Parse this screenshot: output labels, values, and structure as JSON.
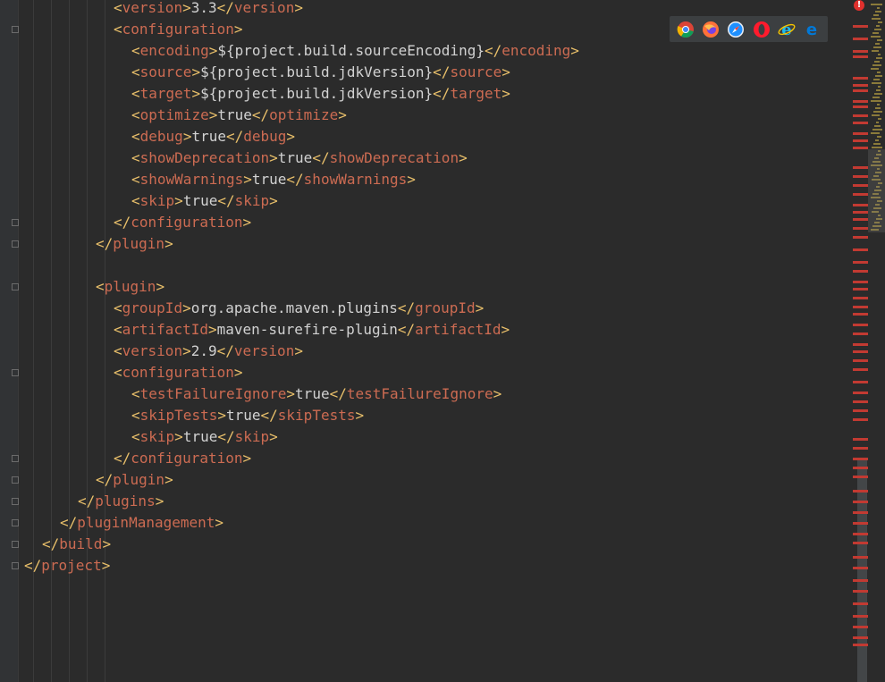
{
  "code": {
    "lines": [
      {
        "indent": 10,
        "parts": [
          {
            "k": "b",
            "s": "<"
          },
          {
            "k": "t",
            "s": "version"
          },
          {
            "k": "b",
            "s": ">"
          },
          {
            "k": "v",
            "s": "3.3"
          },
          {
            "k": "b",
            "s": "</"
          },
          {
            "k": "t",
            "s": "version"
          },
          {
            "k": "b",
            "s": ">"
          }
        ]
      },
      {
        "indent": 10,
        "parts": [
          {
            "k": "b",
            "s": "<"
          },
          {
            "k": "t",
            "s": "configuration"
          },
          {
            "k": "b",
            "s": ">"
          }
        ]
      },
      {
        "indent": 12,
        "parts": [
          {
            "k": "b",
            "s": "<"
          },
          {
            "k": "t",
            "s": "encoding"
          },
          {
            "k": "b",
            "s": ">"
          },
          {
            "k": "v",
            "s": "${project.build.sourceEncoding}"
          },
          {
            "k": "b",
            "s": "</"
          },
          {
            "k": "t",
            "s": "encoding"
          },
          {
            "k": "b",
            "s": ">"
          }
        ]
      },
      {
        "indent": 12,
        "parts": [
          {
            "k": "b",
            "s": "<"
          },
          {
            "k": "t",
            "s": "source"
          },
          {
            "k": "b",
            "s": ">"
          },
          {
            "k": "v",
            "s": "${project.build.jdkVersion}"
          },
          {
            "k": "b",
            "s": "</"
          },
          {
            "k": "t",
            "s": "source"
          },
          {
            "k": "b",
            "s": ">"
          }
        ]
      },
      {
        "indent": 12,
        "parts": [
          {
            "k": "b",
            "s": "<"
          },
          {
            "k": "t",
            "s": "target"
          },
          {
            "k": "b",
            "s": ">"
          },
          {
            "k": "v",
            "s": "${project.build.jdkVersion}"
          },
          {
            "k": "b",
            "s": "</"
          },
          {
            "k": "t",
            "s": "target"
          },
          {
            "k": "b",
            "s": ">"
          }
        ]
      },
      {
        "indent": 12,
        "parts": [
          {
            "k": "b",
            "s": "<"
          },
          {
            "k": "t",
            "s": "optimize"
          },
          {
            "k": "b",
            "s": ">"
          },
          {
            "k": "v",
            "s": "true"
          },
          {
            "k": "b",
            "s": "</"
          },
          {
            "k": "t",
            "s": "optimize"
          },
          {
            "k": "b",
            "s": ">"
          }
        ]
      },
      {
        "indent": 12,
        "parts": [
          {
            "k": "b",
            "s": "<"
          },
          {
            "k": "t",
            "s": "debug"
          },
          {
            "k": "b",
            "s": ">"
          },
          {
            "k": "v",
            "s": "true"
          },
          {
            "k": "b",
            "s": "</"
          },
          {
            "k": "t",
            "s": "debug"
          },
          {
            "k": "b",
            "s": ">"
          }
        ]
      },
      {
        "indent": 12,
        "parts": [
          {
            "k": "b",
            "s": "<"
          },
          {
            "k": "t",
            "s": "showDeprecation"
          },
          {
            "k": "b",
            "s": ">"
          },
          {
            "k": "v",
            "s": "true"
          },
          {
            "k": "b",
            "s": "</"
          },
          {
            "k": "t",
            "s": "showDeprecation"
          },
          {
            "k": "b",
            "s": ">"
          }
        ]
      },
      {
        "indent": 12,
        "parts": [
          {
            "k": "b",
            "s": "<"
          },
          {
            "k": "t",
            "s": "showWarnings"
          },
          {
            "k": "b",
            "s": ">"
          },
          {
            "k": "v",
            "s": "true"
          },
          {
            "k": "b",
            "s": "</"
          },
          {
            "k": "t",
            "s": "showWarnings"
          },
          {
            "k": "b",
            "s": ">"
          }
        ]
      },
      {
        "indent": 12,
        "parts": [
          {
            "k": "b",
            "s": "<"
          },
          {
            "k": "t",
            "s": "skip"
          },
          {
            "k": "b",
            "s": ">"
          },
          {
            "k": "v",
            "s": "true"
          },
          {
            "k": "b",
            "s": "</"
          },
          {
            "k": "t",
            "s": "skip"
          },
          {
            "k": "b",
            "s": ">"
          }
        ]
      },
      {
        "indent": 10,
        "parts": [
          {
            "k": "b",
            "s": "</"
          },
          {
            "k": "t",
            "s": "configuration"
          },
          {
            "k": "b",
            "s": ">"
          }
        ]
      },
      {
        "indent": 8,
        "parts": [
          {
            "k": "b",
            "s": "</"
          },
          {
            "k": "t",
            "s": "plugin"
          },
          {
            "k": "b",
            "s": ">"
          }
        ]
      },
      {
        "indent": 0,
        "parts": []
      },
      {
        "indent": 8,
        "parts": [
          {
            "k": "b",
            "s": "<"
          },
          {
            "k": "t",
            "s": "plugin"
          },
          {
            "k": "b",
            "s": ">"
          }
        ]
      },
      {
        "indent": 10,
        "parts": [
          {
            "k": "b",
            "s": "<"
          },
          {
            "k": "t",
            "s": "groupId"
          },
          {
            "k": "b",
            "s": ">"
          },
          {
            "k": "v",
            "s": "org.apache.maven.plugins"
          },
          {
            "k": "b",
            "s": "</"
          },
          {
            "k": "t",
            "s": "groupId"
          },
          {
            "k": "b",
            "s": ">"
          }
        ]
      },
      {
        "indent": 10,
        "parts": [
          {
            "k": "b",
            "s": "<"
          },
          {
            "k": "t",
            "s": "artifactId"
          },
          {
            "k": "b",
            "s": ">"
          },
          {
            "k": "v",
            "s": "maven-surefire-plugin"
          },
          {
            "k": "b",
            "s": "</"
          },
          {
            "k": "t",
            "s": "artifactId"
          },
          {
            "k": "b",
            "s": ">"
          }
        ]
      },
      {
        "indent": 10,
        "parts": [
          {
            "k": "b",
            "s": "<"
          },
          {
            "k": "t",
            "s": "version"
          },
          {
            "k": "b",
            "s": ">"
          },
          {
            "k": "v",
            "s": "2.9"
          },
          {
            "k": "b",
            "s": "</"
          },
          {
            "k": "t",
            "s": "version"
          },
          {
            "k": "b",
            "s": ">"
          }
        ]
      },
      {
        "indent": 10,
        "parts": [
          {
            "k": "b",
            "s": "<"
          },
          {
            "k": "t",
            "s": "configuration"
          },
          {
            "k": "b",
            "s": ">"
          }
        ]
      },
      {
        "indent": 12,
        "parts": [
          {
            "k": "b",
            "s": "<"
          },
          {
            "k": "t",
            "s": "testFailureIgnore"
          },
          {
            "k": "b",
            "s": ">"
          },
          {
            "k": "v",
            "s": "true"
          },
          {
            "k": "b",
            "s": "</"
          },
          {
            "k": "t",
            "s": "testFailureIgnore"
          },
          {
            "k": "b",
            "s": ">"
          }
        ]
      },
      {
        "indent": 12,
        "parts": [
          {
            "k": "b",
            "s": "<"
          },
          {
            "k": "t",
            "s": "skipTests"
          },
          {
            "k": "b",
            "s": ">"
          },
          {
            "k": "v",
            "s": "true"
          },
          {
            "k": "b",
            "s": "</"
          },
          {
            "k": "t",
            "s": "skipTests"
          },
          {
            "k": "b",
            "s": ">"
          }
        ]
      },
      {
        "indent": 12,
        "parts": [
          {
            "k": "b",
            "s": "<"
          },
          {
            "k": "t",
            "s": "skip"
          },
          {
            "k": "b",
            "s": ">"
          },
          {
            "k": "v",
            "s": "true"
          },
          {
            "k": "b",
            "s": "</"
          },
          {
            "k": "t",
            "s": "skip"
          },
          {
            "k": "b",
            "s": ">"
          }
        ]
      },
      {
        "indent": 10,
        "parts": [
          {
            "k": "b",
            "s": "</"
          },
          {
            "k": "t",
            "s": "configuration"
          },
          {
            "k": "b",
            "s": ">"
          }
        ]
      },
      {
        "indent": 8,
        "parts": [
          {
            "k": "b",
            "s": "</"
          },
          {
            "k": "t",
            "s": "plugin"
          },
          {
            "k": "b",
            "s": ">"
          }
        ]
      },
      {
        "indent": 6,
        "parts": [
          {
            "k": "b",
            "s": "</"
          },
          {
            "k": "t",
            "s": "plugins"
          },
          {
            "k": "b",
            "s": ">"
          }
        ]
      },
      {
        "indent": 4,
        "parts": [
          {
            "k": "b",
            "s": "</"
          },
          {
            "k": "t",
            "s": "pluginManagement"
          },
          {
            "k": "b",
            "s": ">"
          }
        ]
      },
      {
        "indent": 2,
        "parts": [
          {
            "k": "b",
            "s": "</"
          },
          {
            "k": "t",
            "s": "build"
          },
          {
            "k": "b",
            "s": ">"
          }
        ]
      },
      {
        "indent": 0,
        "parts": [
          {
            "k": "b",
            "s": "</"
          },
          {
            "k": "t",
            "s": "project"
          },
          {
            "k": "b",
            "s": ">"
          }
        ]
      }
    ]
  },
  "browsers": [
    {
      "name": "chrome-icon",
      "color": "#4285f4"
    },
    {
      "name": "firefox-icon",
      "color": "#ff7139"
    },
    {
      "name": "safari-icon",
      "color": "#1e90ff"
    },
    {
      "name": "opera-icon",
      "color": "#ff1b2d"
    },
    {
      "name": "internet-explorer-icon",
      "color": "#1ebbee"
    },
    {
      "name": "edge-icon",
      "color": "#0078d7"
    }
  ],
  "colors": {
    "background": "#2b2b2b",
    "tag_bracket": "#e8bf6a",
    "tag_name": "#cc6b52",
    "text": "#d2d2d2",
    "error": "#c23a32"
  }
}
